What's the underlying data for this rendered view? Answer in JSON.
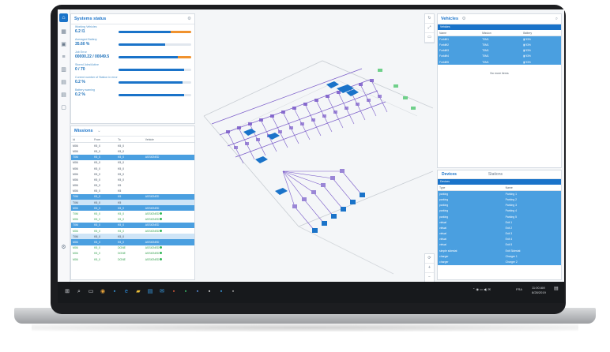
{
  "colors": {
    "accent": "#1a73c9",
    "orange": "#f0922e",
    "selected_row": "#4a9fe0",
    "ok": "#35b85a",
    "map_route": "#7a5bc9"
  },
  "rail_icons": [
    "home-icon",
    "grid-icon",
    "box-icon",
    "list-icon",
    "chart-icon",
    "doc-icon",
    "doc-icon",
    "clipboard-icon",
    "settings-icon"
  ],
  "systems_status": {
    "title": "Systems status",
    "metrics": [
      {
        "label": "Working Vehicles",
        "value": "6.2 I1",
        "fill": 0.72,
        "orange": 0.28,
        "button": "arrow-right-icon"
      },
      {
        "label": "Averaged Battery",
        "value": "35.60 %",
        "fill": 0.64,
        "orange": 0.0,
        "button": "arrow-right-icon"
      },
      {
        "label": "Job Error",
        "value": "00000.22 / 00049.5",
        "fill": 0.82,
        "orange": 0.18,
        "button": "warning-icon"
      },
      {
        "label": "Stored Jobs/Active",
        "value": "0 / 70",
        "fill": 0.9,
        "orange": 0.0,
        "button": "arrow-right-icon"
      },
      {
        "label": "Current number of Station in error",
        "value": "0.2 %",
        "fill": 0.88,
        "orange": 0.0,
        "button": "arrow-right-icon"
      },
      {
        "label": "Battery warning",
        "value": "0.2 %",
        "fill": 0.9,
        "orange": 0.0,
        "button": "arrow-right-icon"
      }
    ]
  },
  "missions": {
    "title": "Missions",
    "headers": [
      "Id",
      "From",
      "To",
      "Vehicle"
    ],
    "rows": [
      {
        "id": "M06",
        "from": "K5_0",
        "to": "K5_0",
        "veh": "",
        "style": ""
      },
      {
        "id": "M06",
        "from": "K5_0",
        "to": "K5_0",
        "veh": "",
        "style": ""
      },
      {
        "id": "T0M",
        "from": "K5_0",
        "to": "K5_0",
        "veh": "ASSIGNED",
        "style": "sel"
      },
      {
        "id": "M06",
        "from": "K5_0",
        "to": "K5_0",
        "veh": "",
        "style": ""
      },
      {
        "id": "M06",
        "from": "K5_0",
        "to": "K5_0",
        "veh": "",
        "style": ""
      },
      {
        "id": "M06",
        "from": "K5_0",
        "to": "K5_0",
        "veh": "",
        "style": ""
      },
      {
        "id": "M06",
        "from": "K5_0",
        "to": "K5_0",
        "veh": "",
        "style": ""
      },
      {
        "id": "M06",
        "from": "K5_0",
        "to": "K5",
        "veh": "",
        "style": ""
      },
      {
        "id": "M06",
        "from": "K5_0",
        "to": "K5",
        "veh": "",
        "style": ""
      },
      {
        "id": "T0M",
        "from": "K5_0",
        "to": "K5",
        "veh": "ASSIGNED",
        "style": "sel"
      },
      {
        "id": "T0M",
        "from": "K5_0",
        "to": "K5",
        "veh": "",
        "style": "lt"
      },
      {
        "id": "M06",
        "from": "K5_0",
        "to": "K5_0",
        "veh": "ASSIGNED",
        "style": "sel"
      },
      {
        "id": "T0M",
        "from": "K5_0",
        "to": "K5_0",
        "veh": "ASSIGNED",
        "style": "ok"
      },
      {
        "id": "M06",
        "from": "K5_0",
        "to": "K5_0",
        "veh": "ASSIGNED",
        "style": "ok"
      },
      {
        "id": "T0M",
        "from": "K5_0",
        "to": "K5_0",
        "veh": "ASSIGNED",
        "style": "sel"
      },
      {
        "id": "M06",
        "from": "K5_0",
        "to": "K5_0",
        "veh": "ASSIGNED",
        "style": "ok"
      },
      {
        "id": "T0M",
        "from": "K5_0",
        "to": "K5_0",
        "veh": "",
        "style": "lt"
      },
      {
        "id": "M06",
        "from": "K5_0",
        "to": "K5_0",
        "veh": "ASSIGNED",
        "style": "sel"
      },
      {
        "id": "M06",
        "from": "K5_0",
        "to": "DONE",
        "veh": "ASSIGNED",
        "style": "ok"
      },
      {
        "id": "M06",
        "from": "K5_0",
        "to": "DONE",
        "veh": "ASSIGNED",
        "style": "ok"
      },
      {
        "id": "M06",
        "from": "K5_0",
        "to": "DONE",
        "veh": "ASSIGNED",
        "style": "ok"
      }
    ]
  },
  "vehicles": {
    "title": "Vehicles",
    "header_bar": "Vehicles",
    "headers": [
      "Name",
      "Mission",
      "Battery"
    ],
    "rows": [
      {
        "name": "Forklift1",
        "mission": "T0M1",
        "battery": "93%"
      },
      {
        "name": "Forklift2",
        "mission": "T0M1",
        "battery": "93%"
      },
      {
        "name": "Forklift3",
        "mission": "T0M1",
        "battery": "93%"
      },
      {
        "name": "Forklift4",
        "mission": "T0M1",
        "battery": "93%"
      },
      {
        "name": "Forklift5",
        "mission": "T0M1",
        "battery": "93%"
      }
    ],
    "empty_text": "No more items"
  },
  "devices": {
    "tab_devices": "Devices",
    "tab_stations": "Stations",
    "header_bar": "Devices",
    "headers": [
      "Type",
      "Name"
    ],
    "rows": [
      {
        "type": "parking",
        "name": "Parking 1"
      },
      {
        "type": "parking",
        "name": "Parking 2"
      },
      {
        "type": "parking",
        "name": "Parking 3"
      },
      {
        "type": "parking",
        "name": "Parking 4"
      },
      {
        "type": "parking",
        "name": "Parking 5"
      },
      {
        "type": "virtual",
        "name": "Exit 1"
      },
      {
        "type": "virtual",
        "name": "Exit 2"
      },
      {
        "type": "virtual",
        "name": "Exit 3"
      },
      {
        "type": "virtual",
        "name": "Exit 4"
      },
      {
        "type": "virtual",
        "name": "Exit 5"
      },
      {
        "type": "simple sidestat",
        "name": "Exit Sidestat"
      },
      {
        "type": "charger",
        "name": "Charger 1"
      },
      {
        "type": "charger",
        "name": "Charger 2"
      }
    ]
  },
  "map_tools_top": [
    "refresh-icon",
    "zoom-fit-icon",
    "layers-icon"
  ],
  "map_tools_bottom": [
    "rotate-icon",
    "zoom-in-icon",
    "zoom-out-icon"
  ],
  "taskbar": {
    "apps": [
      "windows-icon",
      "search-icon",
      "task-view-icon",
      "chrome-icon",
      "app-icon",
      "edge-icon",
      "explorer-icon",
      "store-icon",
      "mail-icon",
      "app-icon",
      "app-icon",
      "app-icon",
      "app-icon",
      "app-icon",
      "app-icon"
    ],
    "tray_lang": "FRA",
    "time": "11:00 AM",
    "date": "8/28/2019"
  }
}
